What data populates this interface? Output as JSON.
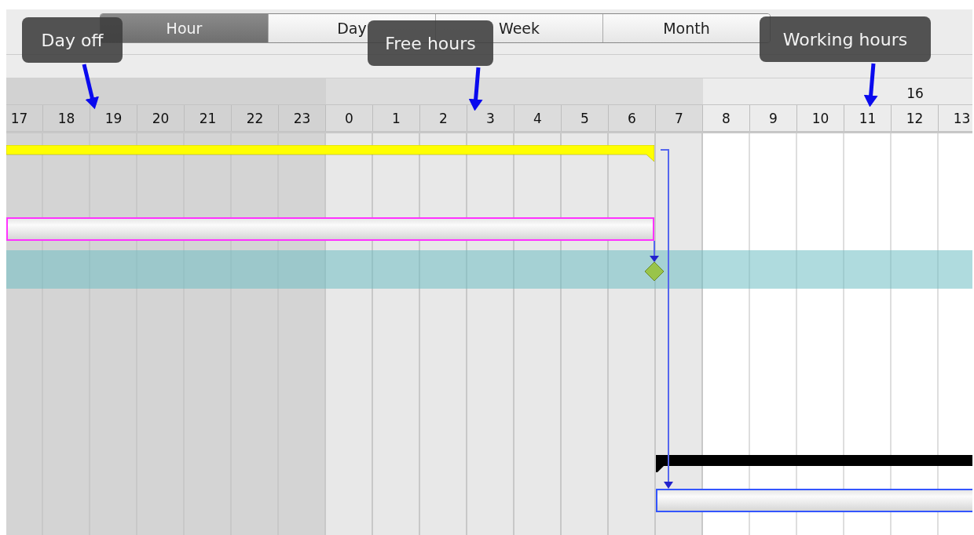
{
  "scale_tabs": [
    {
      "label": "Hour",
      "selected": true
    },
    {
      "label": "Day",
      "selected": false
    },
    {
      "label": "Week",
      "selected": false
    },
    {
      "label": "Month",
      "selected": false
    }
  ],
  "hours": [
    {
      "label": "17",
      "kind": "day_off"
    },
    {
      "label": "18",
      "kind": "day_off"
    },
    {
      "label": "19",
      "kind": "day_off"
    },
    {
      "label": "20",
      "kind": "day_off"
    },
    {
      "label": "21",
      "kind": "day_off"
    },
    {
      "label": "22",
      "kind": "day_off"
    },
    {
      "label": "23",
      "kind": "day_off"
    },
    {
      "label": "0",
      "kind": "free"
    },
    {
      "label": "1",
      "kind": "free"
    },
    {
      "label": "2",
      "kind": "free"
    },
    {
      "label": "3",
      "kind": "free"
    },
    {
      "label": "4",
      "kind": "free"
    },
    {
      "label": "5",
      "kind": "free"
    },
    {
      "label": "6",
      "kind": "free"
    },
    {
      "label": "7",
      "kind": "free"
    },
    {
      "label": "8",
      "kind": "working"
    },
    {
      "label": "9",
      "kind": "working"
    },
    {
      "label": "10",
      "kind": "working"
    },
    {
      "label": "11",
      "kind": "working"
    },
    {
      "label": "12",
      "kind": "working",
      "day_label": "16"
    },
    {
      "label": "13",
      "kind": "working"
    }
  ],
  "rows": [
    {
      "kind": "summary",
      "color": "#ffff00"
    },
    {
      "kind": "task",
      "color": "#ff33ff"
    },
    {
      "kind": "milestone",
      "selected": true
    },
    {
      "kind": "summary",
      "color": "#000000"
    },
    {
      "kind": "task",
      "color": "#3355ff"
    }
  ],
  "callouts": [
    {
      "text": "Day off"
    },
    {
      "text": "Free hours"
    },
    {
      "text": "Working hours"
    }
  ]
}
